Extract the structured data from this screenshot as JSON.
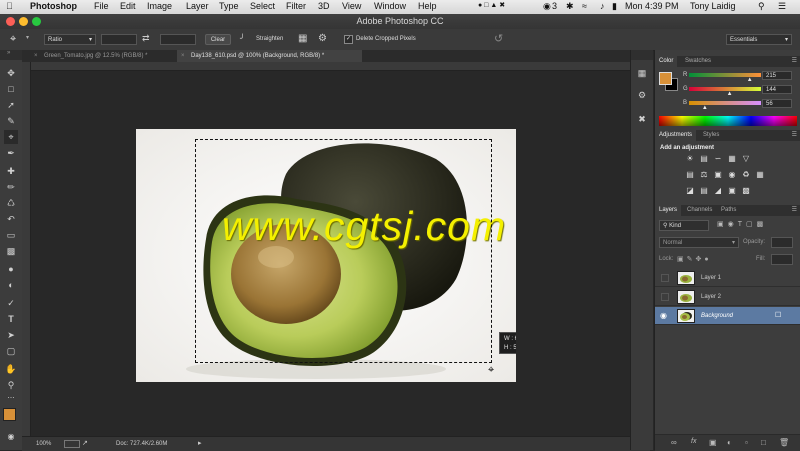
{
  "menubar": {
    "apple": "",
    "app": "Photoshop",
    "items": [
      "File",
      "Edit",
      "Image",
      "Layer",
      "Type",
      "Select",
      "Filter",
      "3D",
      "View",
      "Window",
      "Help"
    ],
    "notif_count": "3",
    "clock": "Mon 4:39 PM",
    "user": "Tony Laidig"
  },
  "window": {
    "title": "Adobe Photoshop CC"
  },
  "options": {
    "ratio": "Ratio",
    "clear": "Clear",
    "straighten": "Straighten",
    "delete_cropped": "Delete Cropped Pixels",
    "workspace": "Essentials"
  },
  "tabs": [
    {
      "label": "Green_Tomato.jpg @ 12.5% (RGB/8) *"
    },
    {
      "label": "Day138_610.psd @ 100% (Background, RGB/8) *"
    }
  ],
  "canvas": {
    "watermark": "www.cgtsj.com",
    "crop_w": "W : 6.569 in",
    "crop_h": "H : 5.014 in"
  },
  "status": {
    "zoom": "100%",
    "doc": "Doc: 727.4K/2.60M"
  },
  "color_panel": {
    "tabs": [
      "Color",
      "Swatches"
    ],
    "r_label": "R",
    "g_label": "G",
    "b_label": "B",
    "r": "215",
    "g": "144",
    "b": "56",
    "r_frac": 0.843,
    "g_frac": 0.565,
    "b_frac": 0.22,
    "foreground": "#d79038",
    "background": "#000000"
  },
  "adjustments": {
    "tabs": [
      "Adjustments",
      "Styles"
    ],
    "heading": "Add an adjustment"
  },
  "layers_panel": {
    "tabs": [
      "Layers",
      "Channels",
      "Paths"
    ],
    "filter": "Kind",
    "blend": "Normal",
    "opacity_label": "Opacity:",
    "lock_label": "Lock:",
    "fill_label": "Fill:",
    "layers": [
      {
        "name": "Layer 1",
        "visible": false,
        "selected": false
      },
      {
        "name": "Layer 2",
        "visible": false,
        "selected": false
      },
      {
        "name": "Background",
        "visible": true,
        "selected": true
      }
    ]
  }
}
